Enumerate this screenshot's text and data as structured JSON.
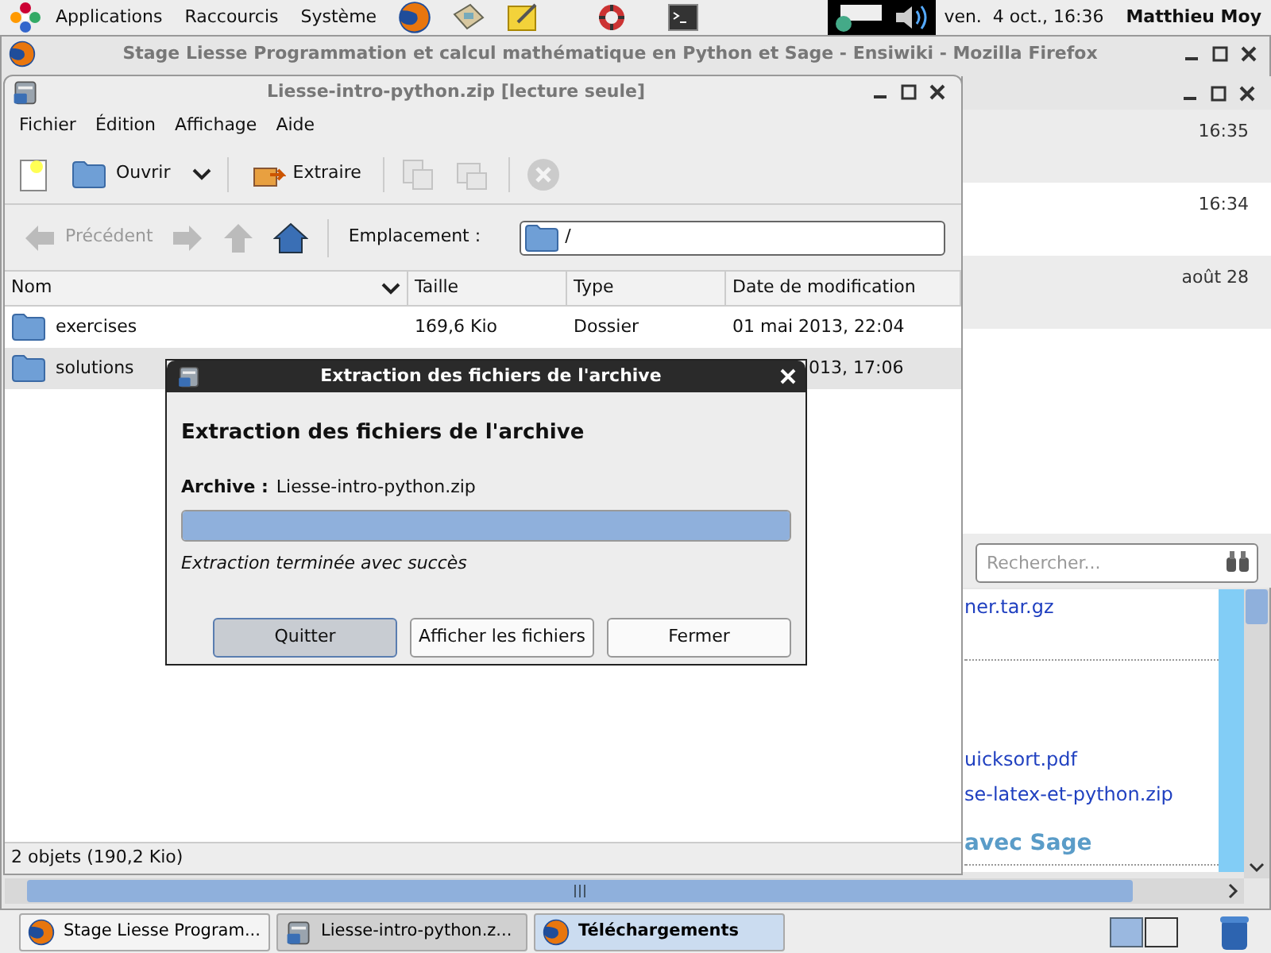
{
  "top_panel": {
    "menus": [
      "Applications",
      "Raccourcis",
      "Système"
    ],
    "clock": "ven.  4 oct., 16:36",
    "user": "Matthieu Moy"
  },
  "firefox": {
    "title": "Stage Liesse Programmation et calcul mathématique en Python et Sage - Ensiwiki - Mozilla Firefox",
    "page_links": [
      "ner.tar.gz",
      "uicksort.pdf",
      "se-latex-et-python.zip"
    ],
    "page_heading": "avec Sage"
  },
  "downloads": {
    "items": [
      {
        "time": "16:35"
      },
      {
        "time": "16:34"
      },
      {
        "time": "août 28"
      }
    ],
    "search": {
      "placeholder": "Rechercher..."
    }
  },
  "archive_window": {
    "title": "Liesse-intro-python.zip [lecture seule]",
    "menu": [
      "Fichier",
      "Édition",
      "Affichage",
      "Aide"
    ],
    "toolbar": {
      "open": "Ouvrir",
      "extract": "Extraire"
    },
    "nav": {
      "back": "Précédent",
      "location_label": "Emplacement :",
      "location": "/"
    },
    "columns": [
      "Nom",
      "Taille",
      "Type",
      "Date de modification"
    ],
    "rows": [
      {
        "name": "exercises",
        "size": "169,6 Kio",
        "type": "Dossier",
        "date": "01 mai 2013, 22:04",
        "selected": false,
        "partly_hidden": false
      },
      {
        "name": "solutions",
        "date": "013, 17:06",
        "selected": true,
        "partly_hidden": true
      }
    ],
    "status": "2 objets (190,2 Kio)"
  },
  "dialog": {
    "title": "Extraction des fichiers de l'archive",
    "heading": "Extraction des fichiers de l'archive",
    "archive_label": "Archive :",
    "archive": "Liesse-intro-python.zip",
    "level": 1,
    "message": "Extraction terminée avec succès",
    "buttons": [
      {
        "label": "Quitter",
        "selected": true
      },
      {
        "label": "Afficher les fichiers",
        "selected": false
      },
      {
        "label": "Fermer",
        "selected": false
      }
    ]
  },
  "taskbar": [
    {
      "label": "Stage Liesse Program...",
      "kind": "browser",
      "active": false
    },
    {
      "label": "Liesse-intro-python.z...",
      "kind": "archive",
      "active": true
    },
    {
      "label": "Téléchargements",
      "kind": "browser",
      "active": false
    }
  ]
}
